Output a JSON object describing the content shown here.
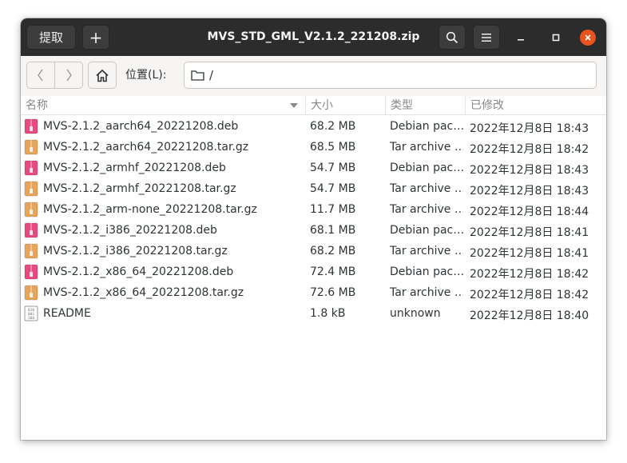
{
  "header": {
    "extract_label": "提取",
    "add_label": "+",
    "title": "MVS_STD_GML_V2.1.2_221208.zip"
  },
  "toolbar": {
    "location_label": "位置(L):",
    "path": "/"
  },
  "columns": {
    "name": "名称",
    "size": "大小",
    "type": "类型",
    "modified": "已修改"
  },
  "colors": {
    "deb_icon": "#e84a7f",
    "tar_icon": "#e9a45c",
    "accent_close": "#e95420",
    "headerbar": "#2c2c2c"
  },
  "files": [
    {
      "name": "MVS-2.1.2_aarch64_20221208.deb",
      "size": "68.2 MB",
      "type": "Debian pac…",
      "modified": "2022年12月8日 18:43",
      "icon": "deb-package-icon"
    },
    {
      "name": "MVS-2.1.2_aarch64_20221208.tar.gz",
      "size": "68.5 MB",
      "type": "Tar archive …",
      "modified": "2022年12月8日 18:42",
      "icon": "tar-archive-icon"
    },
    {
      "name": "MVS-2.1.2_armhf_20221208.deb",
      "size": "54.7 MB",
      "type": "Debian pac…",
      "modified": "2022年12月8日 18:43",
      "icon": "deb-package-icon"
    },
    {
      "name": "MVS-2.1.2_armhf_20221208.tar.gz",
      "size": "54.7 MB",
      "type": "Tar archive …",
      "modified": "2022年12月8日 18:43",
      "icon": "tar-archive-icon"
    },
    {
      "name": "MVS-2.1.2_arm-none_20221208.tar.gz",
      "size": "11.7 MB",
      "type": "Tar archive …",
      "modified": "2022年12月8日 18:44",
      "icon": "tar-archive-icon"
    },
    {
      "name": "MVS-2.1.2_i386_20221208.deb",
      "size": "68.1 MB",
      "type": "Debian pac…",
      "modified": "2022年12月8日 18:41",
      "icon": "deb-package-icon"
    },
    {
      "name": "MVS-2.1.2_i386_20221208.tar.gz",
      "size": "68.2 MB",
      "type": "Tar archive …",
      "modified": "2022年12月8日 18:41",
      "icon": "tar-archive-icon"
    },
    {
      "name": "MVS-2.1.2_x86_64_20221208.deb",
      "size": "72.4 MB",
      "type": "Debian pac…",
      "modified": "2022年12月8日 18:42",
      "icon": "deb-package-icon"
    },
    {
      "name": "MVS-2.1.2_x86_64_20221208.tar.gz",
      "size": "72.6 MB",
      "type": "Tar archive …",
      "modified": "2022年12月8日 18:42",
      "icon": "tar-archive-icon"
    },
    {
      "name": "README",
      "size": "1.8 kB",
      "type": "unknown",
      "modified": "2022年12月8日 18:40",
      "icon": "binary-file-icon"
    }
  ]
}
